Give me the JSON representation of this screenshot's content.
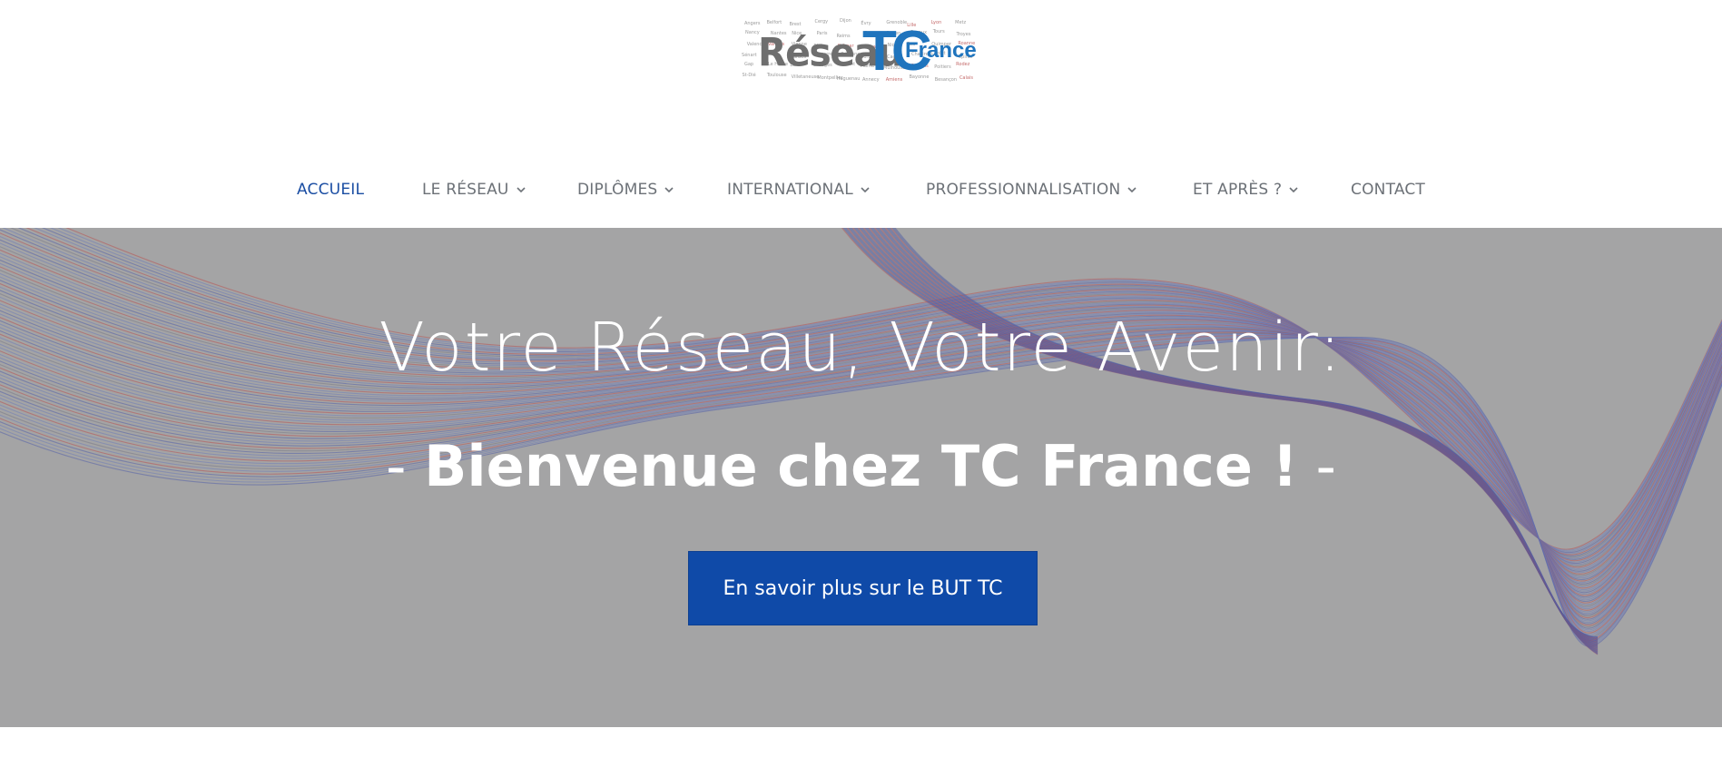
{
  "logo": {
    "word_reseau": "Réseau",
    "word_tc": "TC",
    "word_france": "France",
    "cloud_words": [
      "Angers",
      "Belfort",
      "Brest",
      "Cergy",
      "Dijon",
      "Évry",
      "Grenoble",
      "Lille",
      "Lyon",
      "Metz",
      "Nancy",
      "Nantes",
      "Nice",
      "Paris",
      "Reims",
      "Rennes",
      "Rouen",
      "Sceaux",
      "Tours",
      "Troyes",
      "Valence",
      "Vannes",
      "Vienne",
      "Blois",
      "Colmar",
      "Laval",
      "Niort",
      "Pau",
      "Quimper",
      "Roanne",
      "Sénart",
      "Sète",
      "Tarbes",
      "Auxerre",
      "Béthune",
      "Bordeaux",
      "Caen",
      "Chartres",
      "Cholet",
      "Épinal",
      "Gap",
      "Le Havre",
      "Lens",
      "Limoges",
      "Lorient",
      "Marne",
      "Mulhouse",
      "Orléans",
      "Poitiers",
      "Rodez",
      "St-Dié",
      "Toulouse",
      "Villetaneuse",
      "Montpellier",
      "Haguenau",
      "Annecy",
      "Amiens",
      "Bayonne",
      "Besançon",
      "Calais"
    ]
  },
  "nav": {
    "items": [
      {
        "label": "ACCUEIL",
        "dropdown": false,
        "active": true
      },
      {
        "label": "LE RÉSEAU",
        "dropdown": true,
        "active": false
      },
      {
        "label": "DIPLÔMES",
        "dropdown": true,
        "active": false
      },
      {
        "label": "INTERNATIONAL",
        "dropdown": true,
        "active": false
      },
      {
        "label": "PROFESSIONNALISATION",
        "dropdown": true,
        "active": false
      },
      {
        "label": "ET APRÈS ?",
        "dropdown": true,
        "active": false
      },
      {
        "label": "CONTACT",
        "dropdown": false,
        "active": false
      }
    ]
  },
  "hero": {
    "title": "Votre Réseau, Votre Avenir:",
    "subtitle_dash_left": "- ",
    "subtitle": "Bienvenue chez TC France !",
    "subtitle_dash_right": " -",
    "button_label": "En savoir plus sur le BUT TC"
  },
  "colors": {
    "brand_blue": "#1b4ea3",
    "button_blue": "#0f4aa8",
    "nav_text": "#6c7177",
    "hero_overlay": "#a8a8aa",
    "accent_red": "#c8302e"
  },
  "icons": {
    "dropdown": "chevron-down-icon"
  }
}
